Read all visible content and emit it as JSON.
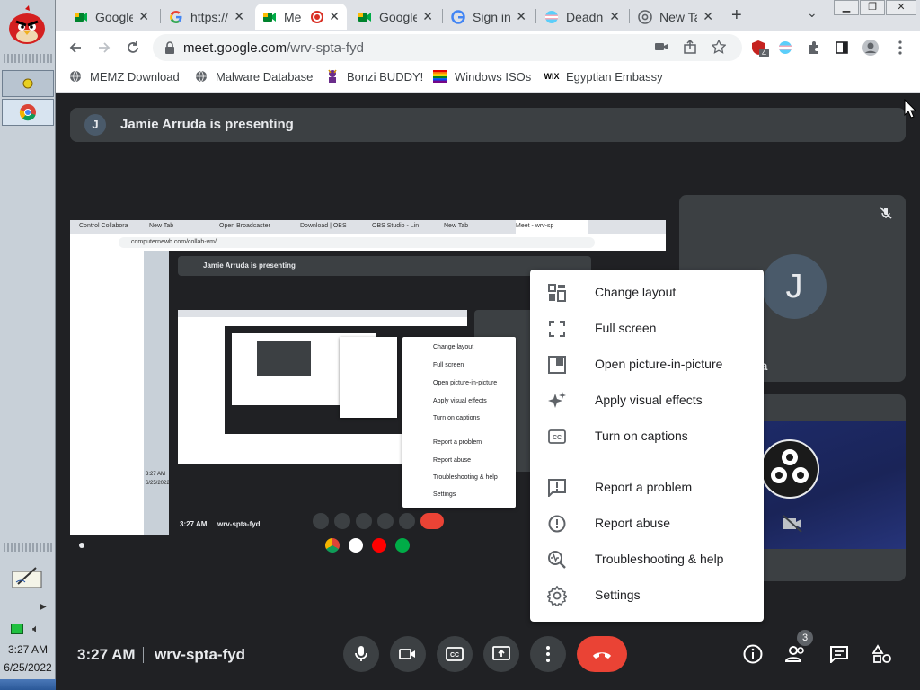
{
  "browser": {
    "tabs": [
      {
        "title": "Google",
        "icon": "meet-icon"
      },
      {
        "title": "https://",
        "icon": "google-icon"
      },
      {
        "title": "Me",
        "icon": "meet-icon",
        "active": true,
        "recording": true
      },
      {
        "title": "Google",
        "icon": "meet-icon"
      },
      {
        "title": "Sign in",
        "icon": "google-icon"
      },
      {
        "title": "Deadn",
        "icon": "flag-icon"
      },
      {
        "title": "New Ta",
        "icon": "chrome-icon"
      }
    ],
    "url_host": "meet.google.com",
    "url_path": "/wrv-spta-fyd",
    "bookmarks": [
      {
        "label": "MEMZ Download",
        "icon": "globe-icon"
      },
      {
        "label": "Malware Database",
        "icon": "globe-icon"
      },
      {
        "label": "Bonzi BUDDY!",
        "icon": "bonzi-icon"
      },
      {
        "label": "Windows ISOs",
        "icon": "windows-icon"
      },
      {
        "label": "Egyptian Embassy",
        "icon": "wix-icon"
      }
    ],
    "extension_badge": "4"
  },
  "meet": {
    "presenter_initial": "J",
    "presenting_text": "Jamie Arruda is presenting",
    "tile_name_partial": "da",
    "time": "3:27 AM",
    "meeting_code": "wrv-spta-fyd",
    "participant_count": "3"
  },
  "menu": {
    "items": [
      {
        "label": "Change layout",
        "icon": "layout-icon"
      },
      {
        "label": "Full screen",
        "icon": "fullscreen-icon"
      },
      {
        "label": "Open picture-in-picture",
        "icon": "pip-icon"
      },
      {
        "label": "Apply visual effects",
        "icon": "sparkle-icon"
      },
      {
        "label": "Turn on captions",
        "icon": "captions-icon"
      },
      {
        "label": "Report a problem",
        "icon": "feedback-icon"
      },
      {
        "label": "Report abuse",
        "icon": "alert-icon"
      },
      {
        "label": "Troubleshooting & help",
        "icon": "troubleshoot-icon"
      },
      {
        "label": "Settings",
        "icon": "settings-icon"
      }
    ]
  },
  "nested": {
    "url": "computernewb.com/collab-vm/",
    "presenting_text": "Jamie Arruda is presenting",
    "time": "3:27 AM",
    "meeting_code": "wrv-spta-fyd",
    "tabs": [
      "Control Collabora",
      "New Tab",
      "Open Broadcaster",
      "Download | OBS",
      "OBS Studio - Lin",
      "New Tab",
      "Meet - wrv-sp"
    ],
    "menu": [
      "Change layout",
      "Full screen",
      "Open picture-in-picture",
      "Apply visual effects",
      "Turn on captions",
      "Report a problem",
      "Report abuse",
      "Troubleshooting & help",
      "Settings"
    ]
  },
  "taskbar": {
    "time": "3:27 AM",
    "date": "6/25/2022"
  },
  "colors": {
    "meet_bg": "#202124",
    "tile_bg": "#3c4043",
    "end_call": "#ea4335",
    "tab_bar": "#dee1e6"
  }
}
